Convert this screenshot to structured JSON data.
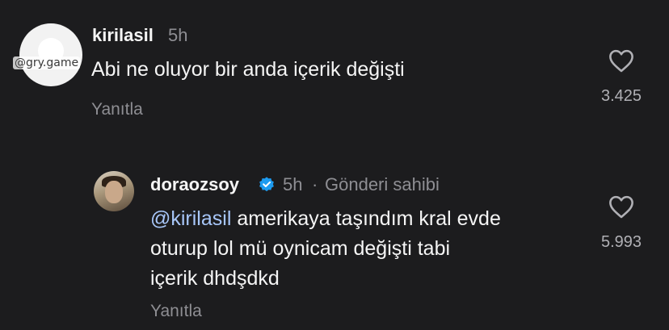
{
  "comments": [
    {
      "username": "kirilasil",
      "time": "5h",
      "text": "Abi ne oluyor bir anda içerik değişti",
      "reply_label": "Yanıtla",
      "likes": "3.425",
      "watermark": "@gry.game"
    },
    {
      "username": "doraozsoy",
      "verified": true,
      "time": "5h",
      "separator": "·",
      "author_tag": "Gönderi sahibi",
      "mention": "@kirilasil",
      "text_line1": "amerikaya taşındım kral evde",
      "text_line2": "oturup lol mü oynicam değişti tabi",
      "text_line3": "içerik dhdşdkd",
      "reply_label": "Yanıtla",
      "likes": "5.993"
    }
  ],
  "icons": {
    "like": "heart-outline-icon",
    "verified": "verified-badge-icon"
  },
  "colors": {
    "background": "#1c1c1e",
    "text": "#f5f5f5",
    "muted": "#8e8e93",
    "mention": "#a8c7fa",
    "verified": "#1d9bf0"
  }
}
